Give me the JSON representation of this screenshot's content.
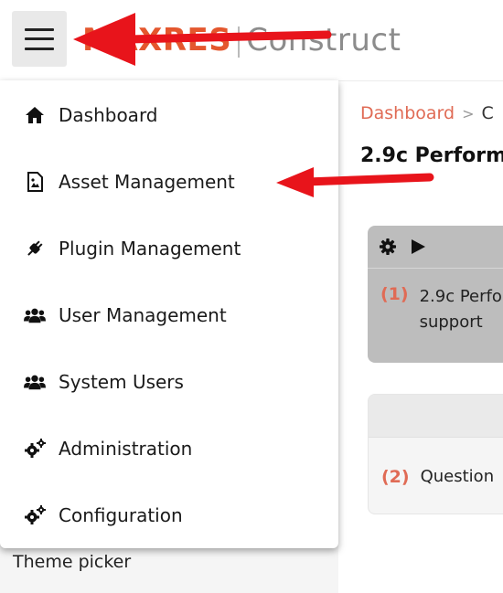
{
  "header": {
    "logo_brand": "MAXRES",
    "logo_separator": "|",
    "logo_product": "Construct",
    "menu_button_icon": "hamburger-icon"
  },
  "menu": {
    "items": [
      {
        "label": "Dashboard",
        "icon": "home-icon"
      },
      {
        "label": "Asset Management",
        "icon": "image-file-icon"
      },
      {
        "label": "Plugin Management",
        "icon": "plug-icon"
      },
      {
        "label": "User Management",
        "icon": "users-icon"
      },
      {
        "label": "System Users",
        "icon": "users-icon"
      },
      {
        "label": "Administration",
        "icon": "gears-icon"
      },
      {
        "label": "Configuration",
        "icon": "gears-icon"
      }
    ]
  },
  "sidebar": {
    "theme_picker": "Theme picker"
  },
  "main": {
    "breadcrumb": {
      "link": "Dashboard",
      "separator": ">",
      "current": "C"
    },
    "page_title": "2.9c Perform",
    "card1": {
      "number": "(1)",
      "text_line1": "2.9c Perfo",
      "text_line2": "support"
    },
    "card2": {
      "number": "(2)",
      "text": "Question"
    }
  },
  "colors": {
    "accent": "#e06b55",
    "brand": "#e4572e",
    "annotation_arrow": "#e8141b"
  }
}
